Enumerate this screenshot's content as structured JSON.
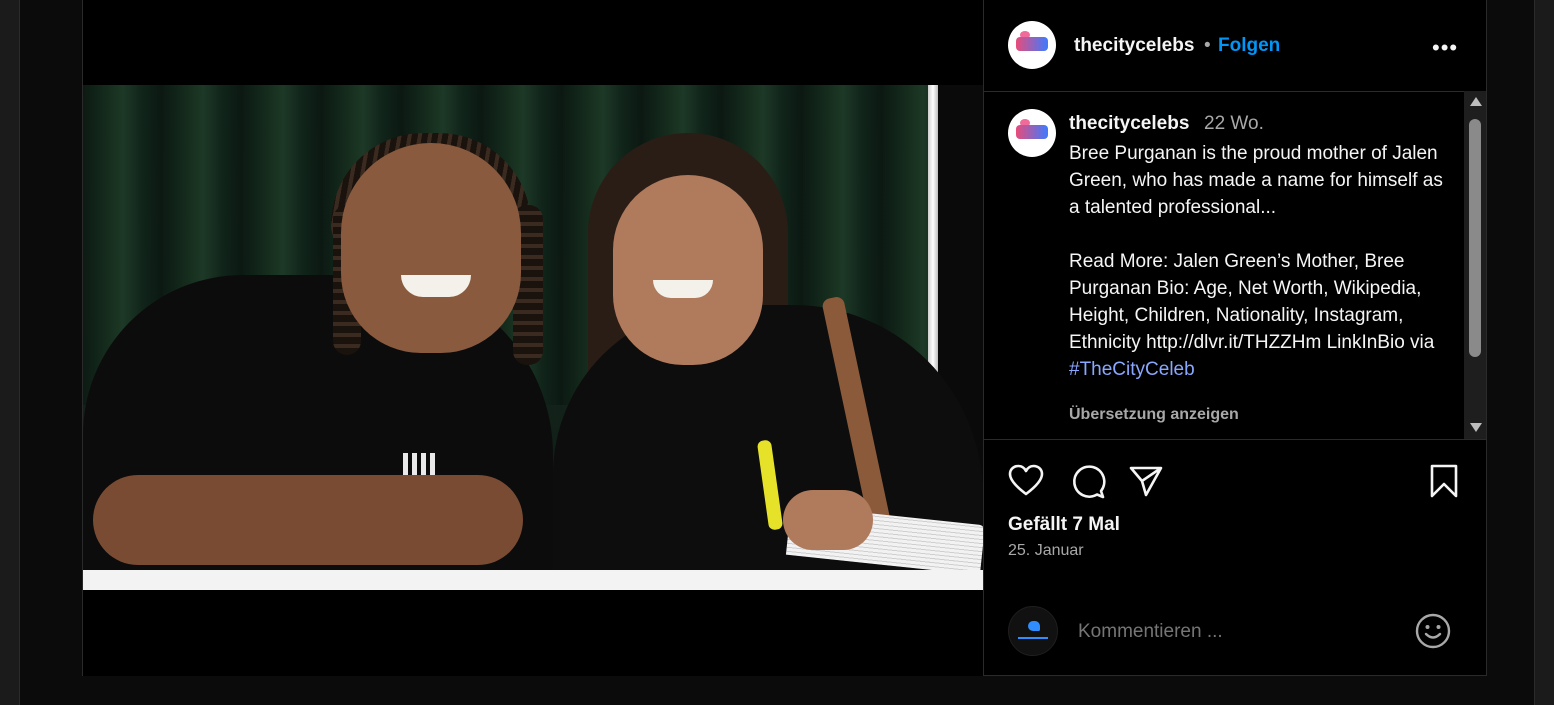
{
  "post": {
    "author": "thecitycelebs",
    "follow_label": "Folgen",
    "separator": "•",
    "more_label": "•••",
    "caption": {
      "username": "thecitycelebs",
      "time_ago": "22 Wo.",
      "text": "Bree Purganan is the proud mother of Jalen Green, who has made a name for himself as a talented professional...\n\nRead More: Jalen Green’s Mother, Bree Purganan Bio: Age, Net Worth, Wikipedia, Height, Children, Nationality, Instagram, Ethnicity http://dlvr.it/THZZHm LinkInBio via",
      "hashtag": "#TheCityCeleb",
      "translate_label": "Übersetzung anzeigen"
    },
    "likes_label": "Gefällt 7 Mal",
    "date_label": "25. Januar",
    "comment_placeholder": "Kommentieren ..."
  },
  "icons": {
    "like": "heart-icon",
    "comment": "comment-icon",
    "share": "send-icon",
    "save": "bookmark-icon",
    "emoji": "emoji-icon",
    "more": "more-icon"
  },
  "colors": {
    "background": "#000000",
    "follow": "#0095f6",
    "hashtag": "#8aa7ff",
    "muted": "#a8a8a8"
  }
}
